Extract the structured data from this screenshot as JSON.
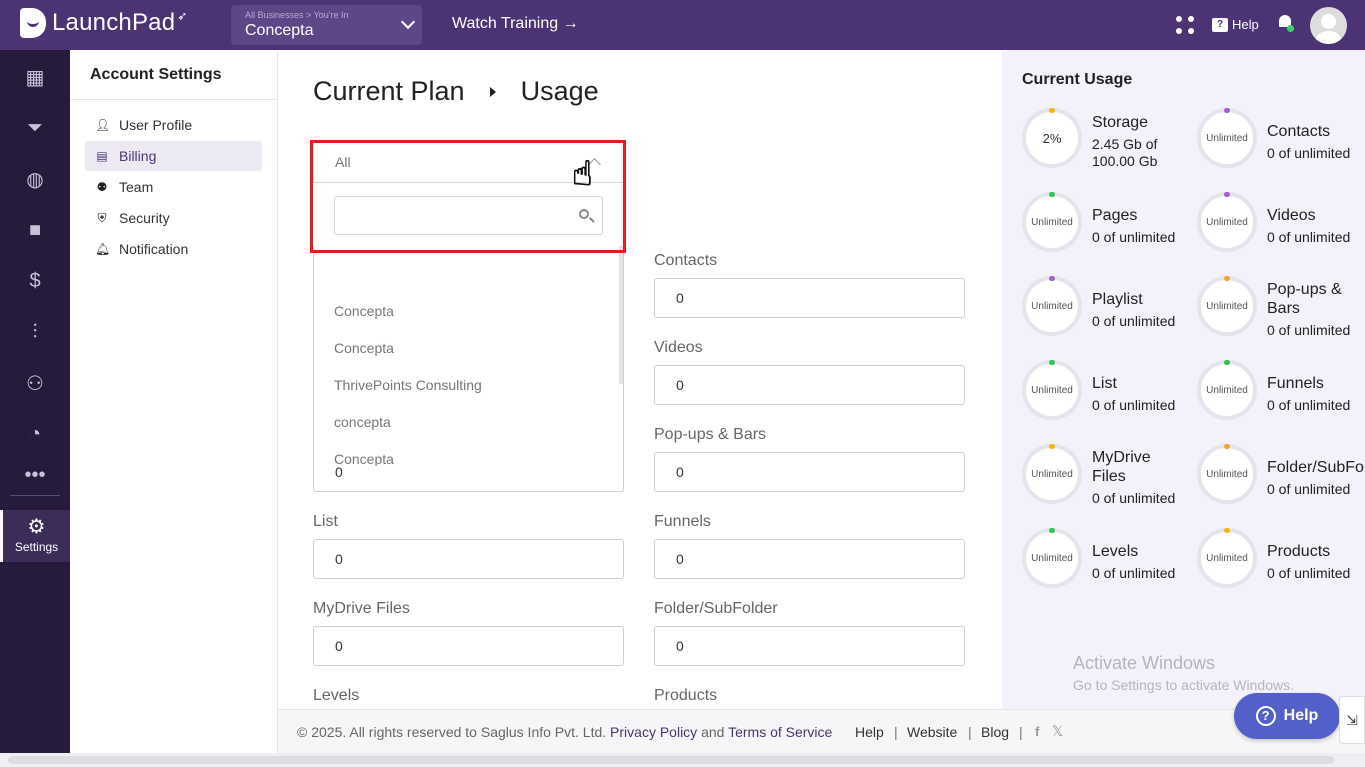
{
  "topbar": {
    "logo_text": "LaunchPad",
    "business_crumb": "All Businesses  >  You're In",
    "business_name": "Concepta",
    "watch_training": "Watch Training →",
    "help_label": "Help"
  },
  "rail": {
    "items": [
      "dashboard-icon",
      "funnel-icon",
      "globe-icon",
      "video-icon",
      "dollar-icon",
      "analytics-icon",
      "people-icon",
      "gauge-icon",
      "more-icon"
    ],
    "settings_label": "Settings"
  },
  "account": {
    "title": "Account Settings",
    "items": [
      {
        "label": "User Profile",
        "icon": "user-icon"
      },
      {
        "label": "Billing",
        "icon": "billing-icon"
      },
      {
        "label": "Team",
        "icon": "team-icon"
      },
      {
        "label": "Security",
        "icon": "shield-icon"
      },
      {
        "label": "Notification",
        "icon": "bell-icon"
      }
    ],
    "active": "Billing"
  },
  "main": {
    "breadcrumb": [
      "Current Plan",
      "Usage"
    ],
    "dropdown": {
      "selected": "All",
      "search_value": "",
      "options": [
        "Concepta",
        "Concepta",
        "ThrivePoints Consulting",
        "concepta",
        "Concepta"
      ]
    },
    "fields": {
      "storage_value": "0",
      "contacts_label": "Contacts",
      "contacts_value": "0",
      "videos_label": "Videos",
      "videos_value": "0",
      "popups_label": "Pop-ups & Bars",
      "popups_value": "0",
      "list_label": "List",
      "list_value": "0",
      "funnels_label": "Funnels",
      "funnels_value": "0",
      "mydrive_label": "MyDrive Files",
      "mydrive_value": "0",
      "folder_label": "Folder/SubFolder",
      "folder_value": "0",
      "levels_label": "Levels",
      "products_label": "Products"
    }
  },
  "usage": {
    "title": "Current Usage",
    "cards": [
      {
        "name": "Storage",
        "ring": "2%",
        "value": "2.45 Gb of 100.00 Gb",
        "dot": "#f5b800"
      },
      {
        "name": "Contacts",
        "ring": "Unlimited",
        "value": "0 of unlimited",
        "dot": "#a35bd6"
      },
      {
        "name": "Pages",
        "ring": "Unlimited",
        "value": "0 of unlimited",
        "dot": "#2ec24a"
      },
      {
        "name": "Videos",
        "ring": "Unlimited",
        "value": "0 of unlimited",
        "dot": "#a35bd6"
      },
      {
        "name": "Playlist",
        "ring": "Unlimited",
        "value": "0 of unlimited",
        "dot": "#a35bd6"
      },
      {
        "name": "Pop-ups & Bars",
        "ring": "Unlimited",
        "value": "0 of unlimited",
        "dot": "#f5a623"
      },
      {
        "name": "List",
        "ring": "Unlimited",
        "value": "0 of unlimited",
        "dot": "#2ec24a"
      },
      {
        "name": "Funnels",
        "ring": "Unlimited",
        "value": "0 of unlimited",
        "dot": "#2ec24a"
      },
      {
        "name": "MyDrive Files",
        "ring": "Unlimited",
        "value": "0 of unlimited",
        "dot": "#f5b800"
      },
      {
        "name": "Folder/SubFolder",
        "ring": "Unlimited",
        "value": "0 of unlimited",
        "dot": "#f5a623"
      },
      {
        "name": "Levels",
        "ring": "Unlimited",
        "value": "0 of unlimited",
        "dot": "#2ec24a"
      },
      {
        "name": "Products",
        "ring": "Unlimited",
        "value": "0 of unlimited",
        "dot": "#f5b800"
      }
    ],
    "watermark_title": "Activate Windows",
    "watermark_sub": "Go to Settings to activate Windows."
  },
  "footer": {
    "copyright": "©  2025. All rights reserved to Saglus Info Pvt. Ltd.",
    "privacy": "Privacy Policy",
    "and": "and",
    "terms": "Terms of Service",
    "links": [
      "Help",
      "Website",
      "Blog"
    ],
    "separator": "|",
    "facebook": "f",
    "x": "𝕏"
  },
  "help_button": "Help",
  "colors": {
    "brand": "#4c3474",
    "rail": "#271b3c",
    "highlight": "#e21b23",
    "help_button": "#5460c9"
  }
}
